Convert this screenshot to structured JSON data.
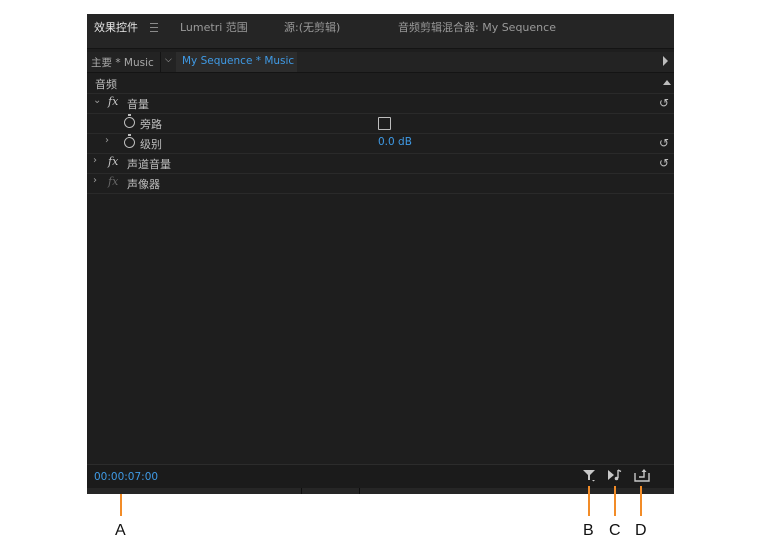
{
  "tabs": [
    {
      "label": "效果控件",
      "active": true
    },
    {
      "label": "Lumetri 范围",
      "active": false
    },
    {
      "label": "源:(无剪辑)",
      "active": false
    },
    {
      "label": "音频剪辑混合器: My Sequence",
      "active": false
    }
  ],
  "clip_bar": {
    "master_label": "主要 * Music",
    "active_label": "My Sequence * Music"
  },
  "section_header": "音频",
  "effects": [
    {
      "label": "音量",
      "fx_enabled": true,
      "expanded": true
    },
    {
      "label": "旁路",
      "type": "checkbox",
      "checked": false
    },
    {
      "label": "级别",
      "value": "0.0 dB"
    },
    {
      "label": "声道音量",
      "fx_enabled": true,
      "expanded": false
    },
    {
      "label": "声像器",
      "fx_enabled": false,
      "expanded": false
    }
  ],
  "footer": {
    "timecode": "00:00:07:00",
    "buttons": [
      {
        "name": "filter-icon"
      },
      {
        "name": "play-audio-icon"
      },
      {
        "name": "export-icon"
      }
    ]
  },
  "callouts": [
    "A",
    "B",
    "C",
    "D"
  ],
  "colors": {
    "panel_bg": "#1e1e1e",
    "accent_blue": "#3f9ae5",
    "callout_orange": "#f28c28"
  }
}
